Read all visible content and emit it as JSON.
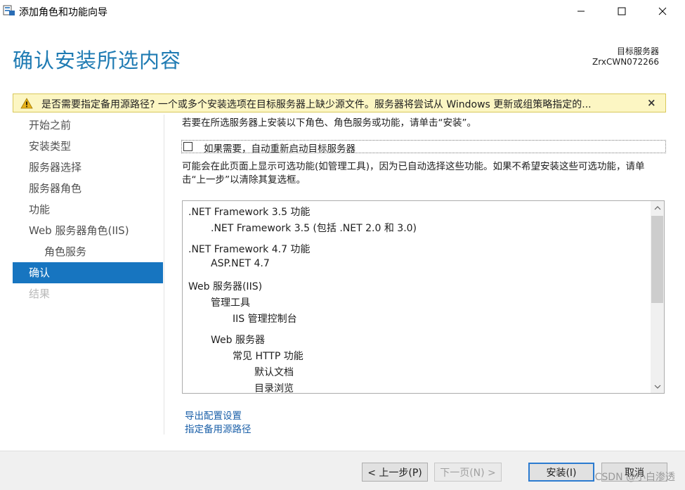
{
  "window": {
    "title": "添加角色和功能向导",
    "controls": {
      "minimize": "minimize",
      "maximize": "maximize",
      "close": "close"
    }
  },
  "header": {
    "page_title": "确认安装所选内容",
    "server_label": "目标服务器",
    "server_name": "ZrxCWN072266"
  },
  "warning": {
    "text": "是否需要指定备用源路径? 一个或多个安装选项在目标服务器上缺少源文件。服务器将尝试从 Windows 更新或组策略指定的...",
    "close": "×",
    "colors": {
      "background": "#fcf6c3",
      "icon": "#e8b21a"
    }
  },
  "nav": {
    "items": [
      {
        "label": "开始之前",
        "state": "normal"
      },
      {
        "label": "安装类型",
        "state": "normal"
      },
      {
        "label": "服务器选择",
        "state": "normal"
      },
      {
        "label": "服务器角色",
        "state": "normal"
      },
      {
        "label": "功能",
        "state": "normal"
      },
      {
        "label": "Web 服务器角色(IIS)",
        "state": "normal"
      },
      {
        "label": "角色服务",
        "state": "sub"
      },
      {
        "label": "确认",
        "state": "selected"
      },
      {
        "label": "结果",
        "state": "disabled"
      }
    ]
  },
  "main": {
    "intro": "若要在所选服务器上安装以下角色、角色服务或功能，请单击“安装”。",
    "restart_label": "如果需要，自动重新启动目标服务器",
    "restart_checked": false,
    "optional_text": "可能会在此页面上显示可选功能(如管理工具)，因为已自动选择这些功能。如果不希望安装这些可选功能，请单击“上一步”以清除其复选框。",
    "features": [
      {
        "text": ".NET Framework 3.5 功能",
        "level": 0
      },
      {
        "text": ".NET Framework 3.5 (包括 .NET 2.0 和 3.0)",
        "level": 1
      },
      {
        "text": ".NET Framework 4.7 功能",
        "level": 0
      },
      {
        "text": "ASP.NET 4.7",
        "level": 1
      },
      {
        "text": "Web 服务器(IIS)",
        "level": 0
      },
      {
        "text": "管理工具",
        "level": 1
      },
      {
        "text": "IIS 管理控制台",
        "level": 2
      },
      {
        "text": "Web 服务器",
        "level": 1
      },
      {
        "text": "常见 HTTP 功能",
        "level": 2
      },
      {
        "text": "默认文档",
        "level": 3
      },
      {
        "text": "目录浏览",
        "level": 3
      }
    ],
    "links": {
      "export": "导出配置设置",
      "alt_source": "指定备用源路径"
    }
  },
  "footer": {
    "prev": "< 上一步(P)",
    "next": "下一页(N) >",
    "install": "安装(I)",
    "cancel": "取消",
    "watermark": "CSDN @小白渗透"
  },
  "colors": {
    "accent": "#1f7bb3",
    "nav_selected": "#1775c0",
    "link": "#1a5fa8"
  }
}
